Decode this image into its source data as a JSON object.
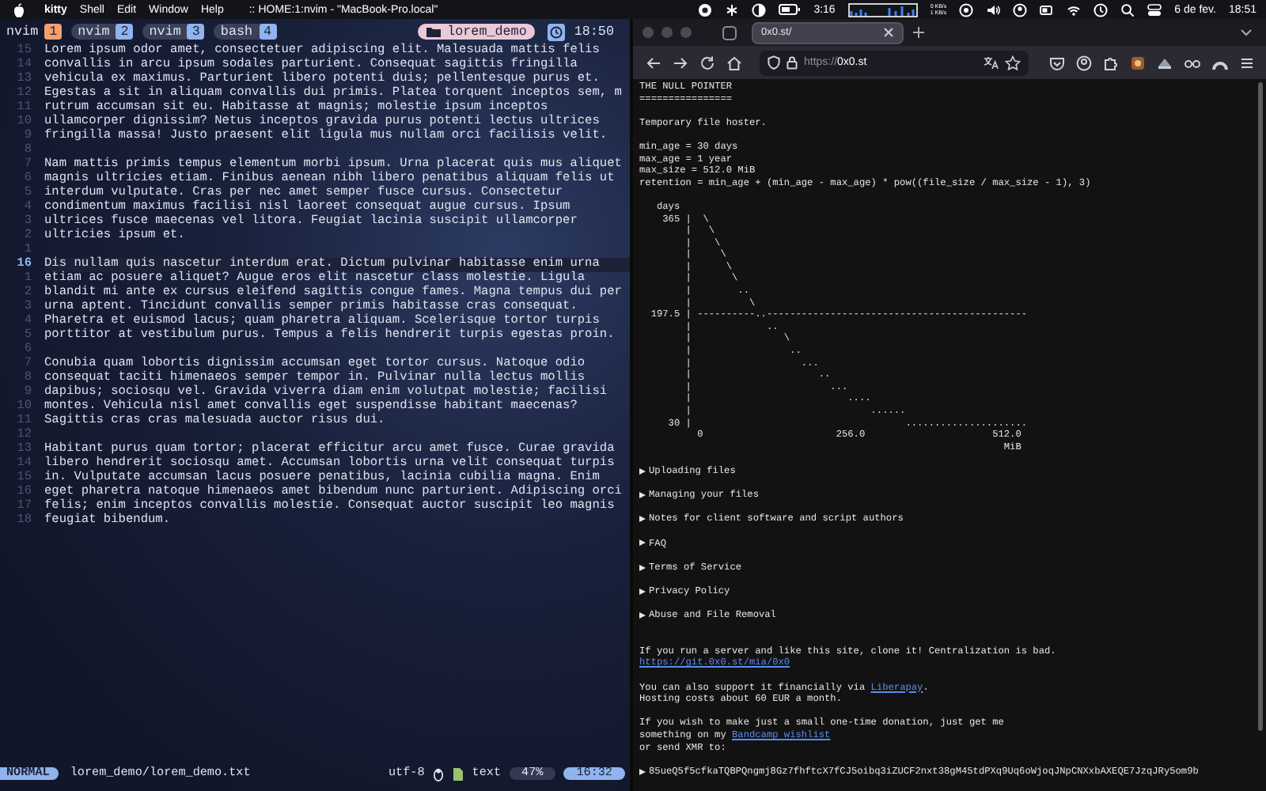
{
  "menubar": {
    "app": "kitty",
    "menus": [
      "Shell",
      "Edit",
      "Window",
      "Help"
    ],
    "title": ":: HOME:1:nvim - \"MacBook-Pro.local\"",
    "battery_time": "3:16",
    "network": [
      "0 KB/s",
      "1 KB/s"
    ],
    "date": "6 de fev.",
    "time": "18:51"
  },
  "terminal": {
    "tabs": [
      {
        "label": "nvim",
        "number": "1",
        "selected": true
      },
      {
        "label": "nvim",
        "number": "2",
        "selected": false
      },
      {
        "label": "nvim",
        "number": "3",
        "selected": false
      },
      {
        "label": "bash",
        "number": "4",
        "selected": false
      }
    ],
    "session": "lorem_demo",
    "clock": "18:50",
    "lines": [
      {
        "number": "15",
        "text": "Lorem ipsum odor amet, consectetuer adipiscing elit. Malesuada mattis felis",
        "current": false
      },
      {
        "number": "14",
        "text": "convallis in arcu ipsum sodales parturient. Consequat sagittis fringilla",
        "current": false
      },
      {
        "number": "13",
        "text": "vehicula ex maximus. Parturient libero potenti duis; pellentesque purus et.",
        "current": false
      },
      {
        "number": "12",
        "text": "Egestas a sit in aliquam convallis dui primis. Platea torquent inceptos sem, m",
        "current": false
      },
      {
        "number": "11",
        "text": "rutrum accumsan sit eu. Habitasse at magnis; molestie ipsum inceptos",
        "current": false
      },
      {
        "number": "10",
        "text": "ullamcorper dignissim? Netus inceptos gravida purus potenti lectus ultrices",
        "current": false
      },
      {
        "number": "9",
        "text": "fringilla massa! Justo praesent elit ligula mus nullam orci facilisis velit.",
        "current": false
      },
      {
        "number": "8",
        "current": false
      },
      {
        "number": "7",
        "text": "Nam mattis primis tempus elementum morbi ipsum. Urna placerat quis mus aliquet",
        "current": false
      },
      {
        "number": "6",
        "text": "magnis ultricies etiam. Finibus aenean nibh libero penatibus aliquam felis ut",
        "current": false
      },
      {
        "number": "5",
        "text": "interdum vulputate. Cras per nec amet semper fusce cursus. Consectetur",
        "current": false
      },
      {
        "number": "4",
        "text": "condimentum maximus facilisi nisl laoreet consequat augue cursus. Ipsum",
        "current": false
      },
      {
        "number": "3",
        "text": "ultrices fusce maecenas vel litora. Feugiat lacinia suscipit ullamcorper",
        "current": false
      },
      {
        "number": "2",
        "text": "ultricies ipsum et.",
        "current": false
      },
      {
        "number": "1",
        "current": false
      },
      {
        "number": "16",
        "text": "Dis nullam quis nascetur interdum erat. Dictum pulvinar habitasse enim urna",
        "current": true
      },
      {
        "number": "1",
        "text": "etiam ac posuere aliquet? Augue eros elit nascetur class molestie. Ligula",
        "current": false
      },
      {
        "number": "2",
        "text": "blandit mi ante ex cursus eleifend sagittis congue fames. Magna tempus dui per",
        "current": false
      },
      {
        "number": "3",
        "text": "urna aptent. Tincidunt convallis semper primis habitasse cras consequat.",
        "current": false
      },
      {
        "number": "4",
        "text": "Pharetra et euismod lacus; quam pharetra aliquam. Scelerisque tortor turpis",
        "current": false
      },
      {
        "number": "5",
        "text": "porttitor at vestibulum purus. Tempus a felis hendrerit turpis egestas proin.",
        "current": false
      },
      {
        "number": "6",
        "current": false
      },
      {
        "number": "7",
        "text": "Conubia quam lobortis dignissim accumsan eget tortor cursus. Natoque odio",
        "current": false
      },
      {
        "number": "8",
        "text": "consequat taciti himenaeos semper tempor in. Pulvinar nulla lectus mollis",
        "current": false
      },
      {
        "number": "9",
        "text": "dapibus; sociosqu vel. Gravida viverra diam enim volutpat molestie; facilisi",
        "current": false
      },
      {
        "number": "10",
        "text": "montes. Vehicula nisl amet convallis eget suspendisse habitant maecenas?",
        "current": false
      },
      {
        "number": "11",
        "text": "Sagittis cras cras malesuada auctor risus dui.",
        "current": false
      },
      {
        "number": "12",
        "current": false
      },
      {
        "number": "13",
        "text": "Habitant purus quam tortor; placerat efficitur arcu amet fusce. Curae gravida",
        "current": false
      },
      {
        "number": "14",
        "text": "libero hendrerit sociosqu amet. Accumsan lobortis urna velit consequat turpis",
        "current": false
      },
      {
        "number": "15",
        "text": "in. Vulputate accumsan lacus posuere penatibus, lacinia cubilia magna. Enim",
        "current": false
      },
      {
        "number": "16",
        "text": "eget pharetra natoque himenaeos amet bibendum nunc parturient. Adipiscing orci",
        "current": false
      },
      {
        "number": "17",
        "text": "felis; enim inceptos convallis molestie. Consequat auctor suscipit leo magnis",
        "current": false
      },
      {
        "number": "18",
        "text": "feugiat bibendum.",
        "current": false
      }
    ],
    "status": {
      "mode": "NORMAL",
      "file": "lorem_demo/lorem_demo.txt",
      "encoding": "utf-8",
      "filetype": "text",
      "percent": "47%",
      "position": "16:32"
    }
  },
  "browser": {
    "tab": {
      "title": "0x0.st/",
      "selected": true
    },
    "url_scheme": "https://",
    "url_host": "0x0.st",
    "page": {
      "heading": "THE NULL POINTER",
      "underline": "================",
      "tagline": "Temporary file hoster.",
      "config": [
        "min_age = 30 days",
        "max_age = 1 year",
        "max_size = 512.0 MiB",
        "retention = min_age + (min_age - max_age) * pow((file_size / max_size - 1), 3)"
      ],
      "graph": [
        "   days",
        "    365 |  \\",
        "        |   \\",
        "        |    \\",
        "        |     \\",
        "        |      \\",
        "        |       \\",
        "        |        ..",
        "        |          \\",
        "  197.5 | ----------..---------------------------------------------",
        "        |             ..",
        "        |                \\",
        "        |                 ..",
        "        |                   ...",
        "        |                      ..",
        "        |                        ...",
        "        |                           ....",
        "        |                               ......",
        "     30 |                                     .....................",
        "          0                       256.0                      512.0",
        "                                                               MiB"
      ],
      "sections": [
        {
          "label": "Uploading files",
          "expanded": false
        },
        {
          "label": "Managing your files",
          "expanded": false
        },
        {
          "label": "Notes for client software and script authors",
          "expanded": false
        },
        {
          "label": "FAQ",
          "expanded": false
        },
        {
          "label": "Terms of Service",
          "expanded": false
        },
        {
          "label": "Privacy Policy",
          "expanded": false
        },
        {
          "label": "Abuse and File Removal",
          "expanded": false
        }
      ],
      "paragraphs": [
        {
          "lines": [
            {
              "text": "If you run a server and like this site, clone it! Centralization is bad."
            },
            {
              "link": "https://git.0x0.st/mia/0x0"
            }
          ]
        },
        {
          "lines": [
            {
              "text": "You can also support it financially via ",
              "link": "Liberapay",
              "after": "."
            },
            {
              "text": "Hosting costs about 60 EUR a month."
            }
          ]
        },
        {
          "lines": [
            {
              "text": "If you wish to make just a small one-time donation, just get me"
            },
            {
              "text": "something on my ",
              "link": "Bandcamp wishlist"
            },
            {
              "text": "or send XMR to:"
            }
          ]
        }
      ],
      "xmr": {
        "label": "85ueQ5f5cfkaTQBPQngmj8Gz7fhftcX7fCJ5oibq3iZUCF2nxt38gM45tdPXq9Uq6oWjoqJNpCNXxbAXEQE7JzqJRy5om9b",
        "expanded": false
      }
    }
  }
}
